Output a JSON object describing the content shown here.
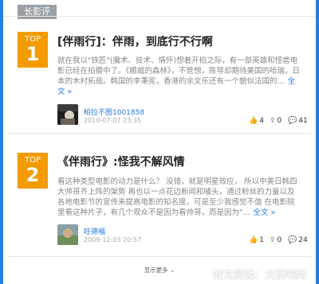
{
  "header": {
    "tab_label": "长影评"
  },
  "items": [
    {
      "rank_label": "TOP",
      "rank_number": "1",
      "title": "[伴雨行]：伴雨，到底行不行啊",
      "excerpt": "就在我以\"铁匠\"(魔术、技术、情怀)想着开拍之际，有一部英雄和怪兽电影已经在拍摄中了。《娜威的森林》，不管想，陈导却期待美国的哈瑞，日本的木村拓哉。韩国的李秉宪，香港的余文乐还有一个貌似法国的...",
      "more_label": "全文 »",
      "author": "柏拉不图1001858",
      "date": "2010-07-07 23:35",
      "stats": {
        "likes": "4",
        "shares": "0",
        "comments": "41"
      }
    },
    {
      "rank_label": "TOP",
      "rank_number": "2",
      "title": "《伴雨行》:怪我不解风情",
      "excerpt": "看这种类型电影的动力是什么？ 没错，就是明星效应， 所以中美日韩四大帅哥齐上阵的架势 再也以一点花边新闻和噱头，通过粉丝的力量以及各地电影节的宣传来提高电影的知名度。可是至少我感觉不值 在电影院里看这种片子，有几个观众不是因为看帅哥，而是因为\"...",
      "more_label": "全文 »",
      "author": "旺德福",
      "date": "2009-12-03 20:57",
      "stats": {
        "likes": "1",
        "shares": "0",
        "comments": "24"
      }
    }
  ],
  "load_more_label": "显示更多",
  "icons": {
    "like": "thumb-up-icon",
    "share": "share-icon",
    "comment": "comment-icon",
    "chevron": "chevron-down-icon"
  },
  "colors": {
    "accent_blue": "#2a7be4",
    "rank_orange": "#f39b00",
    "tab_gray": "#9aa0a6"
  },
  "watermark_text": "好文阅读：文章吧网"
}
